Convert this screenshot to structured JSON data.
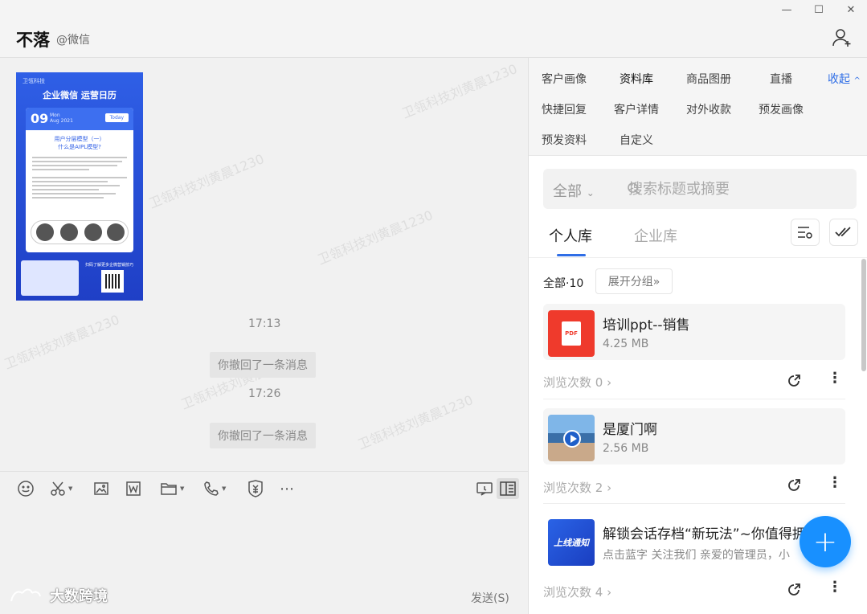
{
  "window": {
    "minimize": "—",
    "maximize": "☐",
    "close": "✕"
  },
  "chat": {
    "title": "不落",
    "subtitle": "@微信",
    "poster": {
      "logo": "卫瓴科技",
      "title": "企业微信 运营日历",
      "day": "09",
      "month": "Mon",
      "month2": "Aug 2021",
      "today": "Today",
      "model_title": "用户分层模型（一）",
      "model_sub": "什么是AIPL模型?",
      "scan_text": "扫码了解更多企微营销技巧"
    },
    "messages": [
      {
        "time": "17:13",
        "text": "你撤回了一条消息"
      },
      {
        "time": "17:26",
        "text": "你撤回了一条消息"
      }
    ],
    "send_label": "发送(S)",
    "brand": "大数跨境"
  },
  "watermark": "卫瓴科技刘黄晨1230",
  "panel": {
    "nav": [
      "客户画像",
      "资料库",
      "商品图册",
      "直播",
      "快捷回复",
      "客户详情",
      "对外收款",
      "预发画像",
      "预发资料",
      "自定义"
    ],
    "collapse": "收起",
    "search_filter": "全部",
    "search_placeholder": "搜索标题或摘要",
    "tabs": {
      "personal": "个人库",
      "enterprise": "企业库"
    },
    "group_all": "全部·10",
    "expand": "展开分组»",
    "files": [
      {
        "name": "培训ppt--销售",
        "size": "4.25 MB",
        "views": "浏览次数 0",
        "thumb": "PDF"
      },
      {
        "name": "是厦门啊",
        "size": "2.56 MB",
        "views": "浏览次数 2",
        "thumb": "video"
      },
      {
        "name": "解锁会话存档“新玩法”~你值得拥",
        "size": "点击蓝字 关注我们 亲爱的管理员，小",
        "views": "浏览次数 4",
        "thumb": "上线通知"
      }
    ]
  },
  "colors": {
    "accent": "#2f6ee6",
    "fab": "#1890ff",
    "pdf": "#ef3a2c"
  }
}
